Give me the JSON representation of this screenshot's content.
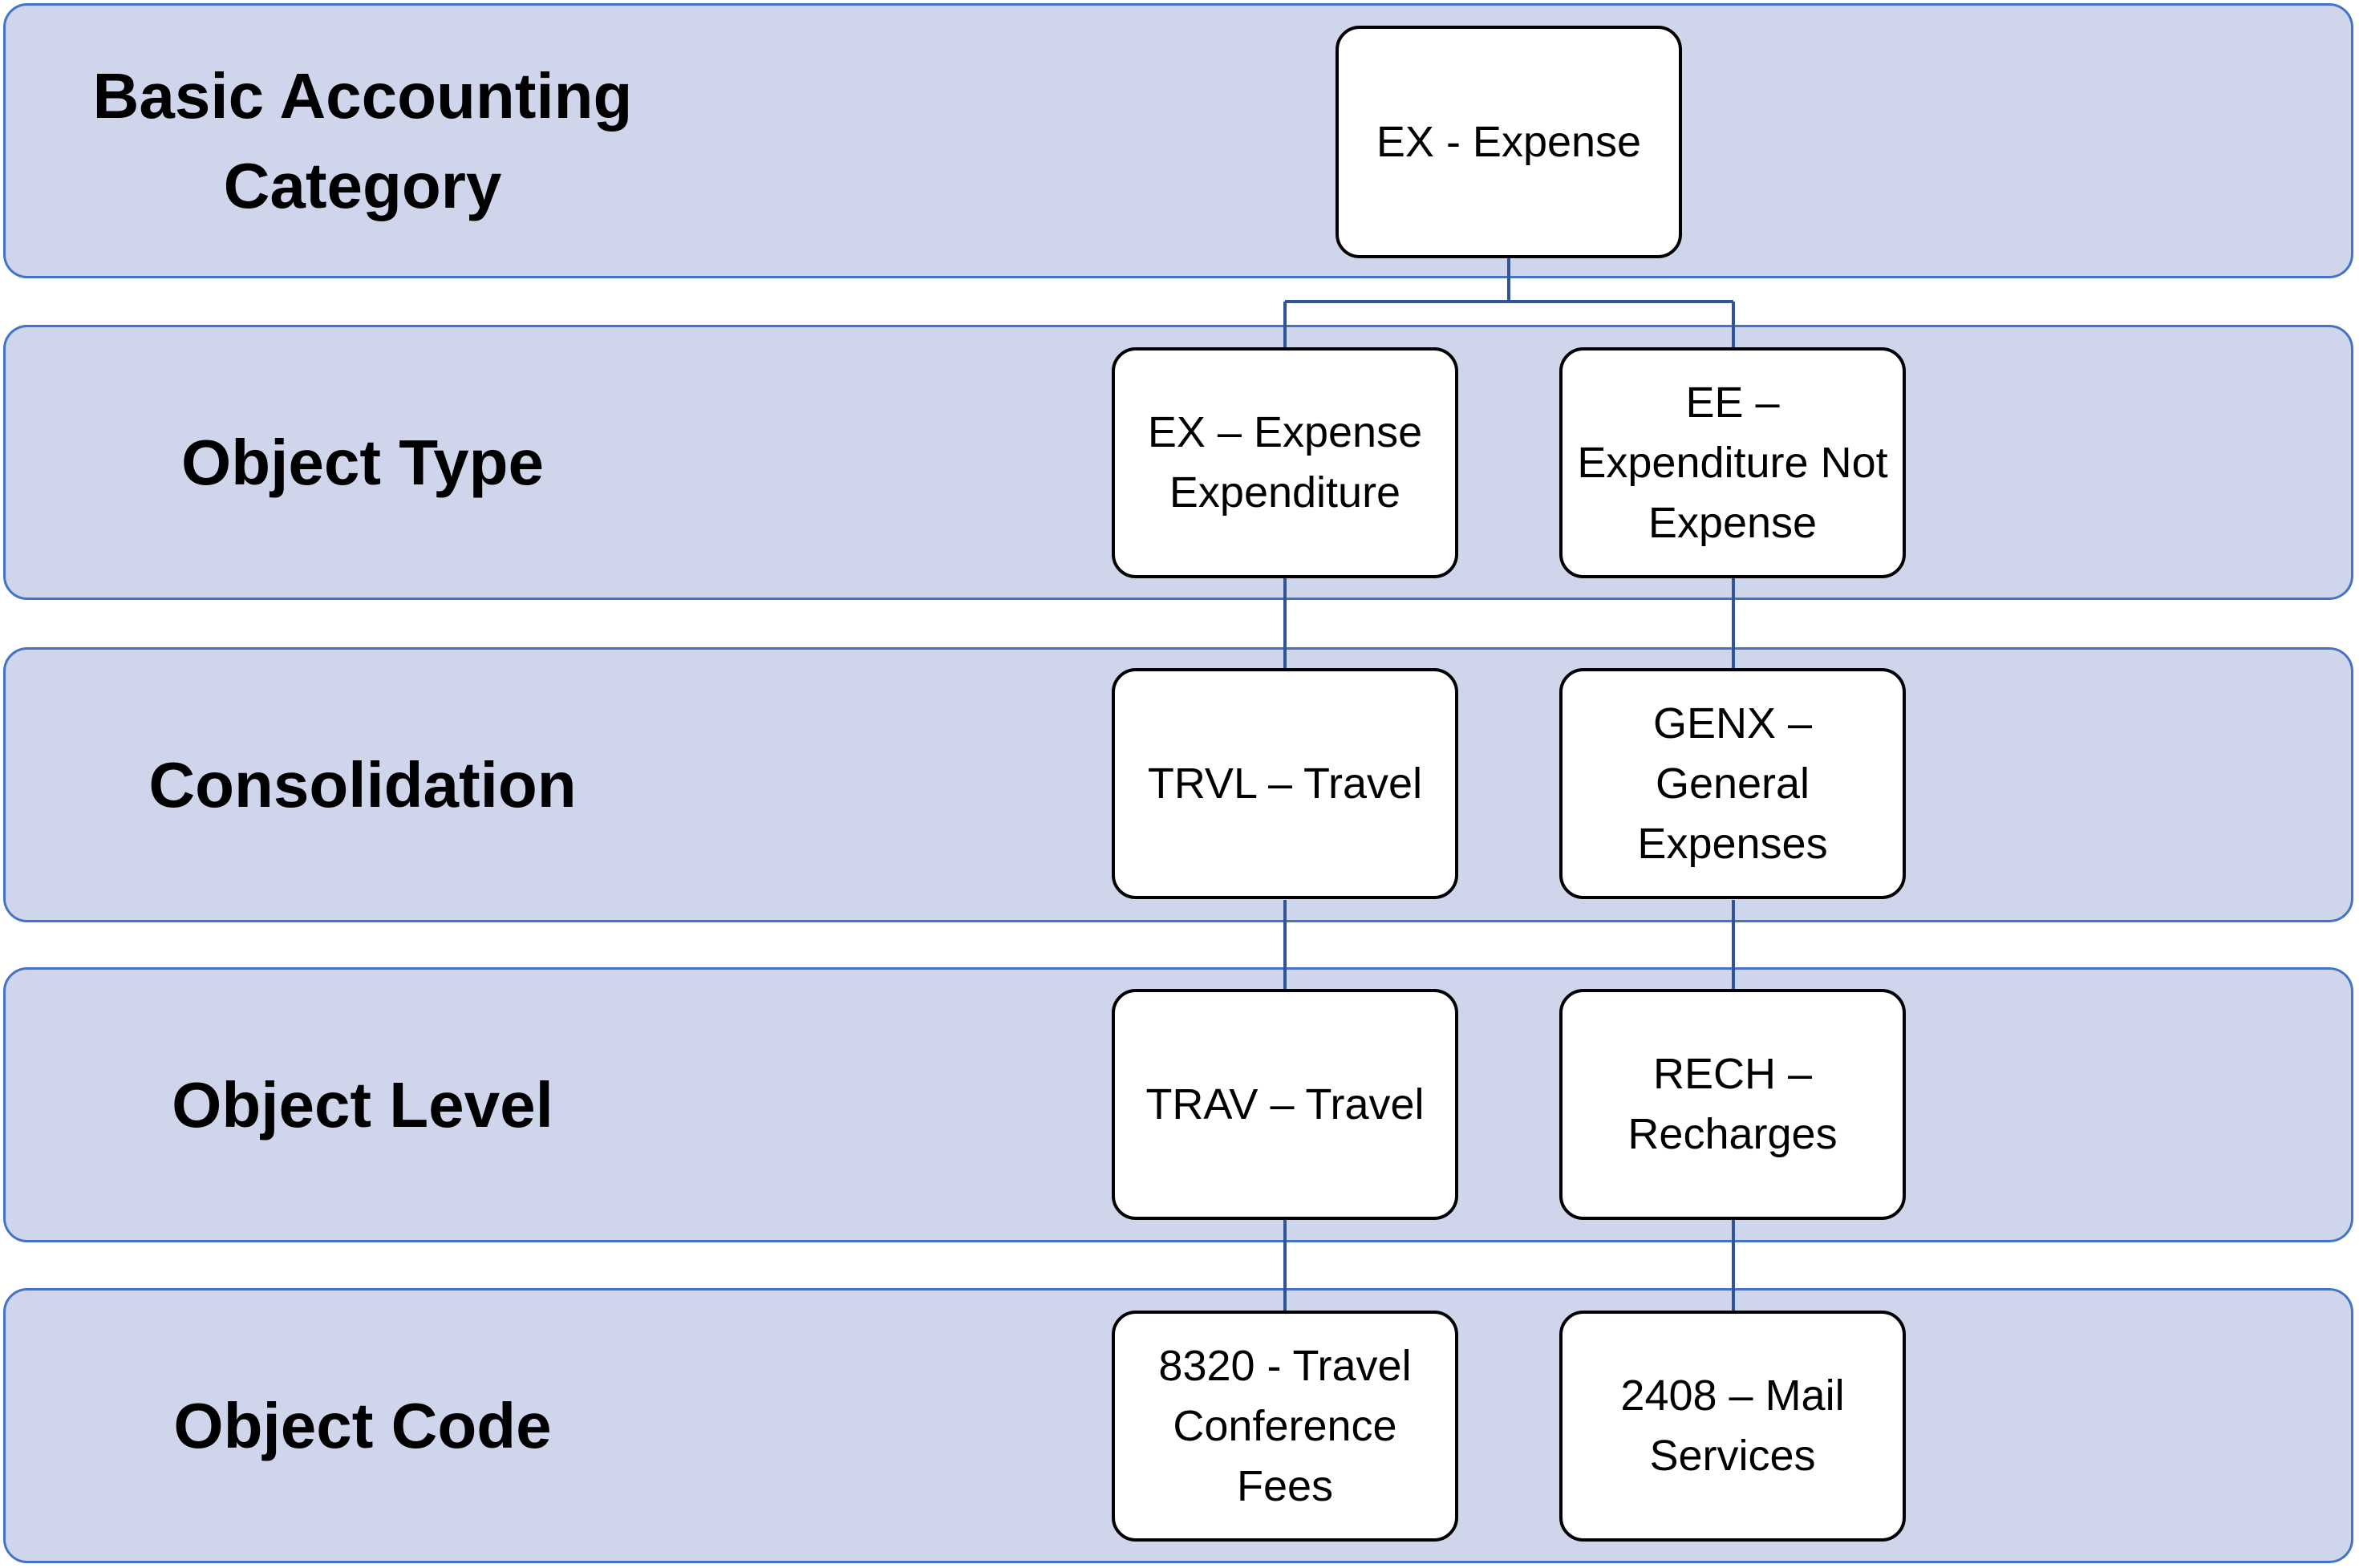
{
  "levels": [
    {
      "label": "Basic Accounting\nCategory"
    },
    {
      "label": "Object Type"
    },
    {
      "label": "Consolidation"
    },
    {
      "label": "Object Level"
    },
    {
      "label": "Object Code"
    }
  ],
  "nodes": {
    "root": "EX - Expense",
    "object_type_left": "EX – Expense Expenditure",
    "object_type_right": "EE – Expenditure Not Expense",
    "consolidation_left": "TRVL – Travel",
    "consolidation_right": "GENX – General Expenses",
    "object_level_left": "TRAV – Travel",
    "object_level_right": "RECH – Recharges",
    "object_code_left": "8320 - Travel Conference Fees",
    "object_code_right": "2408 – Mail Services"
  },
  "colors": {
    "band_fill": "#CFD5EA",
    "band_border": "#4472C4",
    "connector": "#2F5597",
    "node_border": "#000000"
  }
}
